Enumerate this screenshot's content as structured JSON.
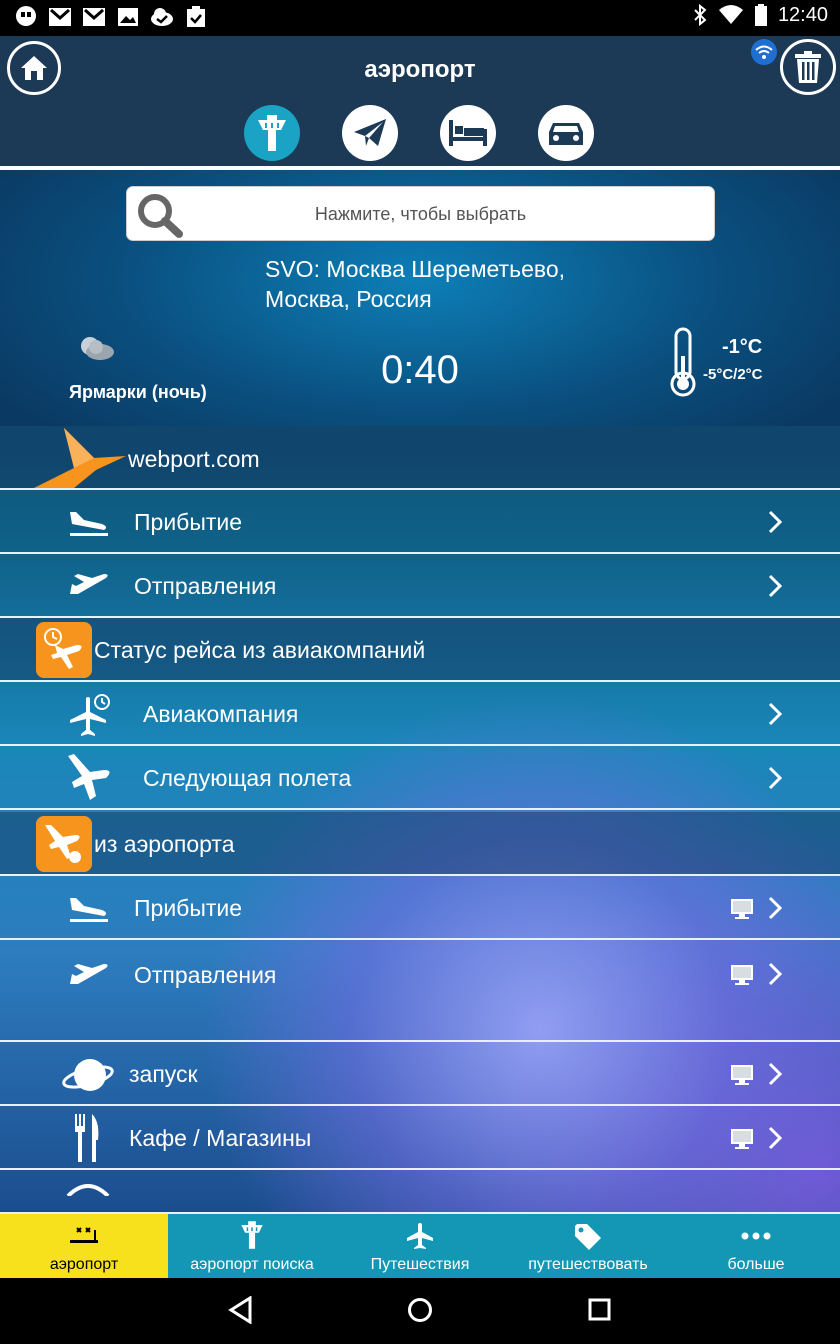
{
  "status_bar": {
    "time": "12:40"
  },
  "header": {
    "title": "аэропорт"
  },
  "search": {
    "placeholder": "Нажмите, чтобы выбрать"
  },
  "airport": {
    "name_line1": "SVO: Москва Шереметьево,",
    "name_line2": "Москва, Россия"
  },
  "weather": {
    "label": "Ярмарки (ночь)",
    "local_time": "0:40",
    "temp_now": "-1°C",
    "temp_range": "-5°C/2°C"
  },
  "menu": {
    "webport": "webport.com",
    "arrivals": "Прибытие",
    "departures": "Отправления",
    "flight_status_section": "Статус рейса из авиакомпаний",
    "airline": "Авиакомпания",
    "next_flight": "Следующая полета",
    "from_airport_section": "из аэропорта",
    "arrivals_2": "Прибытие",
    "departures_2": "Отправления",
    "launch": "запуск",
    "cafe_shops": "Кафе / Магазины"
  },
  "bottom_tabs": [
    "аэропорт",
    "аэропорт поиска",
    "Путешествия",
    "путешествовать",
    "больше"
  ],
  "colors": {
    "accent_yellow": "#f7e11c",
    "tab_bar": "#1397b5",
    "header": "#1c3a55",
    "orange": "#f7941d"
  }
}
